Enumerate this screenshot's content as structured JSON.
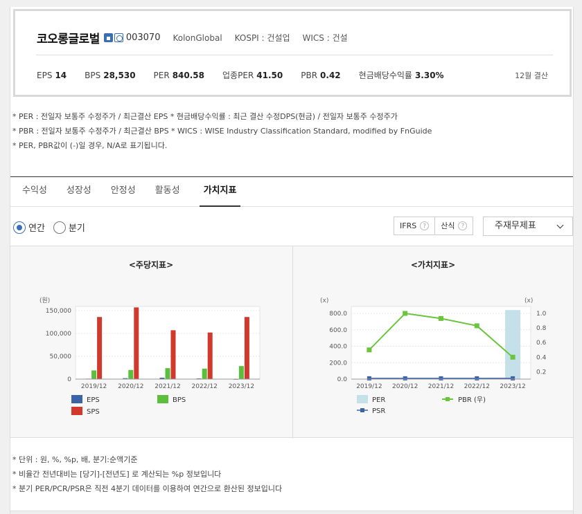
{
  "company": {
    "name": "코오롱글로벌",
    "code": "003070",
    "eng_name": "KolonGlobal",
    "market": "KOSPI : 건설업",
    "wics": "WICS : 건설",
    "fiscal": "12월 결산"
  },
  "metrics": [
    {
      "label": "EPS",
      "value": "14"
    },
    {
      "label": "BPS",
      "value": "28,530"
    },
    {
      "label": "PER",
      "value": "840.58"
    },
    {
      "label": "업종PER",
      "value": "41.50"
    },
    {
      "label": "PBR",
      "value": "0.42"
    },
    {
      "label": "현금배당수익률",
      "value": "3.30%"
    }
  ],
  "notes": [
    "* PER : 전일자 보통주 수정주가 / 최근결산 EPS * 현금배당수익률 : 최근 결산 수정DPS(현금) / 전일자 보통주 수정주가",
    "* PBR : 전일자 보통주 수정주가 / 최근결산 BPS * WICS : WISE Industry Classification Standard, modified by FnGuide",
    "* PER, PBR값이 (-)일 경우, N/A로 표기됩니다."
  ],
  "tabs": [
    "수익성",
    "성장성",
    "안정성",
    "활동성",
    "가치지표"
  ],
  "period": {
    "annual": "연간",
    "quarter": "분기"
  },
  "options": {
    "ifrs": "IFRS",
    "formula": "산식",
    "help": "?",
    "select": "주재무제표"
  },
  "footnotes": [
    "* 단위 : 원, %, %p, 배, 분기:순액기준",
    "* 비율간 전년대비는 [당기]-[전년도] 로 계산되는 %p 정보입니다",
    "* 분기 PER/PCR/PSR은 직전 4분기 데이터를 이용하여 연간으로 환산된 정보입니다"
  ],
  "colors": {
    "eps": "#3a63a8",
    "bps": "#5bbf3c",
    "sps": "#d0392b",
    "per": "#c4e1ea",
    "pbr": "#6bc43e",
    "psr": "#3a63a8"
  },
  "chart_data": [
    {
      "type": "bar",
      "title": "<주당지표>",
      "ylabel": "(원)",
      "categories": [
        "2019/12",
        "2020/12",
        "2021/12",
        "2022/12",
        "2023/12"
      ],
      "ylim": [
        0,
        150000
      ],
      "yticks": [
        0,
        50000,
        100000,
        150000
      ],
      "ytick_labels": [
        "0",
        "50,000",
        "100,000",
        "150,000"
      ],
      "series": [
        {
          "name": "EPS",
          "values": [
            1000,
            2000,
            3000,
            1500,
            14
          ]
        },
        {
          "name": "BPS",
          "values": [
            19000,
            20000,
            24000,
            23000,
            28530
          ]
        },
        {
          "name": "SPS",
          "values": [
            136000,
            157000,
            107000,
            102000,
            136000
          ]
        }
      ],
      "legend": "bottom"
    },
    {
      "type": "line",
      "title": "<가치지표>",
      "ylabel": "(x)",
      "y2label": "(x)",
      "categories": [
        "2019/12",
        "2020/12",
        "2021/12",
        "2022/12",
        "2023/12"
      ],
      "ylim": [
        0,
        800
      ],
      "yticks": [
        0,
        200,
        400,
        600,
        800
      ],
      "ytick_labels": [
        "0.0",
        "200.0",
        "400.0",
        "600.0",
        "800.0"
      ],
      "y2lim": [
        0,
        1.0
      ],
      "y2ticks": [
        0.2,
        0.4,
        0.6,
        0.8,
        1.0
      ],
      "y2tick_labels": [
        "0.2",
        "0.4",
        "0.6",
        "0.8",
        "1.0"
      ],
      "series": [
        {
          "name": "PER",
          "chart": "bar",
          "axis": "left",
          "values": [
            null,
            null,
            null,
            null,
            840.58
          ]
        },
        {
          "name": "PBR (우)",
          "chart": "line",
          "axis": "right",
          "values": [
            0.5,
            1.0,
            0.93,
            0.83,
            0.4
          ]
        },
        {
          "name": "PSR",
          "chart": "line",
          "axis": "left",
          "values": [
            1,
            1,
            1,
            1,
            1
          ]
        }
      ],
      "legend": "bottom"
    }
  ]
}
